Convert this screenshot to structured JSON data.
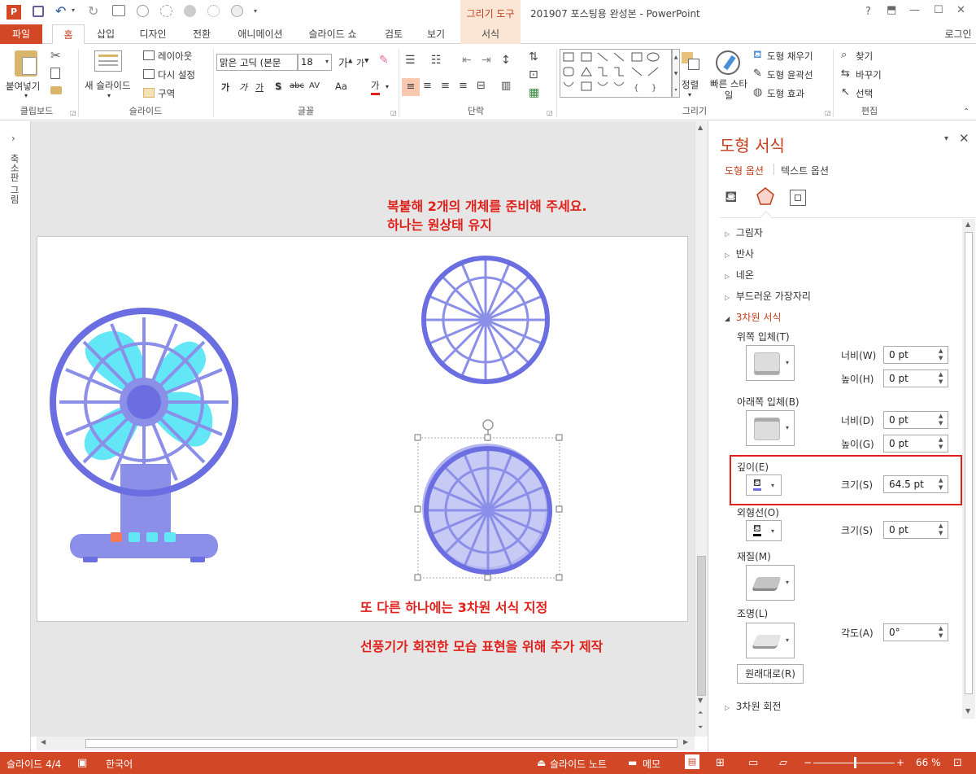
{
  "window": {
    "title": "201907 포스팅용 완성본 - PowerPoint",
    "contextual_tab": "그리기 도구",
    "controls": [
      "?",
      "⬒",
      "—",
      "☐",
      "✕"
    ],
    "login": "로그인"
  },
  "tabs": [
    {
      "label": "파일"
    },
    {
      "label": "홈"
    },
    {
      "label": "삽입"
    },
    {
      "label": "디자인"
    },
    {
      "label": "전환"
    },
    {
      "label": "애니메이션"
    },
    {
      "label": "슬라이드 쇼"
    },
    {
      "label": "검토"
    },
    {
      "label": "보기"
    },
    {
      "label": "서식"
    }
  ],
  "ribbon": {
    "clipboard": {
      "paste": "붙여넣기",
      "group": "클립보드"
    },
    "slides": {
      "new_slide": "새 슬라이드",
      "layout": "레이아웃",
      "reset": "다시 설정",
      "section": "구역",
      "group": "슬라이드"
    },
    "font": {
      "name": "맑은 고딕 (본문",
      "size": "18",
      "group": "글꼴",
      "bold": "가",
      "italic": "가",
      "underline": "가",
      "shadow": "S",
      "strike": "abc",
      "spacing": "AV",
      "case": "Aa",
      "color": "가"
    },
    "paragraph": {
      "group": "단락"
    },
    "drawing": {
      "arrange": "정렬",
      "quick_styles": "빠른 스타일",
      "fill": "도형 채우기",
      "outline": "도형 윤곽선",
      "effects": "도형 효과",
      "group": "그리기"
    },
    "editing": {
      "find": "찾기",
      "replace": "바꾸기",
      "select": "선택",
      "group": "편집"
    }
  },
  "left_pane": {
    "label": "축소판 그림"
  },
  "slide": {
    "note1_line1": "복붙해 2개의 개체를 준비해 주세요.",
    "note1_line2": "하나는 원상태 유지",
    "note2": "또 다른 하나에는 3차원 서식 지정",
    "note3": "선풍기가 회전한 모습 표현을 위해 추가 제작"
  },
  "format_pane": {
    "title": "도형 서식",
    "tab_shape": "도형 옵션",
    "tab_text": "텍스트 옵션",
    "sections": {
      "shadow": "그림자",
      "reflection": "반사",
      "glow": "네온",
      "soft_edges": "부드러운 가장자리",
      "format_3d": "3차원 서식",
      "rotation_3d": "3차원 회전"
    },
    "top_bevel": "위쪽 입체(T)",
    "bottom_bevel": "아래쪽 입체(B)",
    "width_top_label": "너비(W)",
    "height_top_label": "높이(H)",
    "width_top": "0 pt",
    "height_top": "0 pt",
    "width_bottom_label": "너비(D)",
    "height_bottom_label": "높이(G)",
    "width_bottom": "0 pt",
    "height_bottom": "0 pt",
    "depth": "깊이(E)",
    "depth_size_label": "크기(S)",
    "depth_size": "64.5 pt",
    "contour": "외형선(O)",
    "contour_size_label": "크기(S)",
    "contour_size": "0 pt",
    "material": "재질(M)",
    "lighting": "조명(L)",
    "angle_label": "각도(A)",
    "angle": "0°",
    "reset": "원래대로(R)"
  },
  "status": {
    "slide": "슬라이드 4/4",
    "language": "한국어",
    "notes": "슬라이드 노트",
    "comments": "메모",
    "zoom": "66 %",
    "zoom_level": 0.66
  },
  "colors": {
    "accent": "#d24726",
    "fan_dark": "#6a6ee0",
    "fan_light": "#8b8fe8",
    "blade": "#63e6f5",
    "note_red": "#e0201b",
    "highlight_box": "#e0201b"
  }
}
